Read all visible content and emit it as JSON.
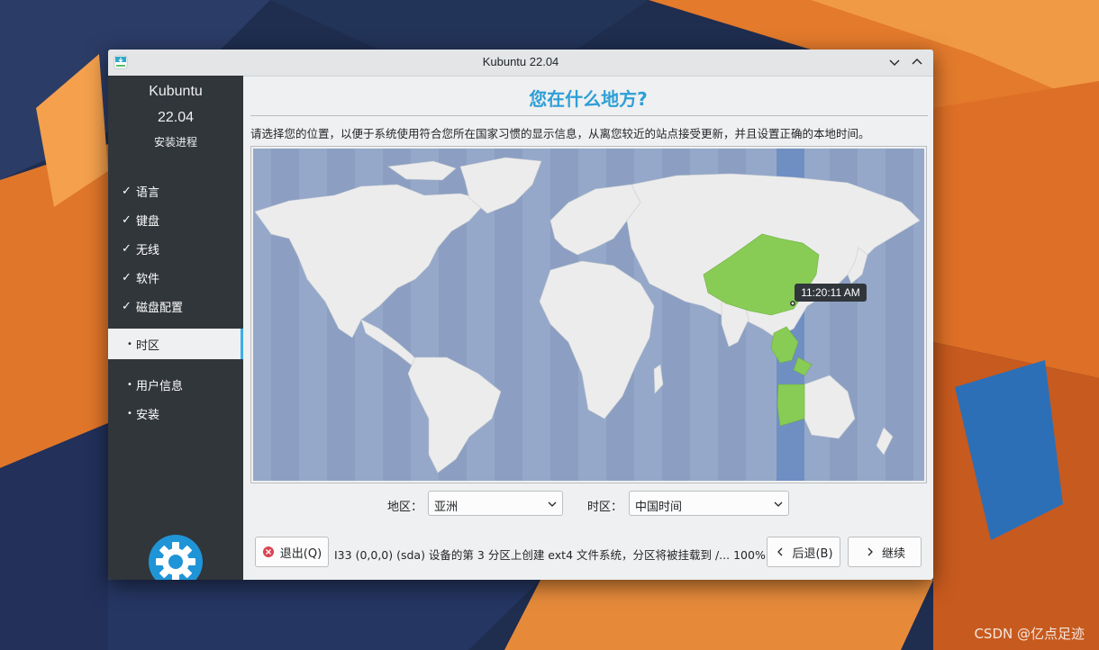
{
  "window": {
    "title": "Kubuntu 22.04"
  },
  "sidebar": {
    "product_name": "Kubuntu",
    "version": "22.04",
    "subtitle": "安装进程",
    "steps": [
      {
        "label": "语言",
        "state": "done",
        "mark": "✓"
      },
      {
        "label": "键盘",
        "state": "done",
        "mark": "✓"
      },
      {
        "label": "无线",
        "state": "done",
        "mark": "✓"
      },
      {
        "label": "软件",
        "state": "done",
        "mark": "✓"
      },
      {
        "label": "磁盘配置",
        "state": "done",
        "mark": "✓"
      },
      {
        "label": "时区",
        "state": "current",
        "mark": "•"
      },
      {
        "label": "用户信息",
        "state": "pending",
        "mark": "•"
      },
      {
        "label": "安装",
        "state": "pending",
        "mark": "•"
      }
    ]
  },
  "main": {
    "title": "您在什么地方?",
    "description": "请选择您的位置，以便于系统使用符合您所在国家习惯的显示信息，从离您较近的站点接受更新，并且设置正确的本地时间。",
    "map": {
      "time_label": "11:20:11 AM",
      "highlight_color": "#88cc55",
      "zone_color": "#6f8fc3"
    },
    "region": {
      "label": "地区：",
      "value": "亚洲"
    },
    "zone": {
      "label": "时区：",
      "value": "中国时间"
    }
  },
  "footer": {
    "quit_label": "退出(Q)",
    "status": "I33 (0,0,0) (sda) 设备的第 3 分区上创建 ext4 文件系统，分区将被挂载到 /... 100%",
    "back_label": "后退(B)",
    "next_label": "继续"
  },
  "watermark": "CSDN @亿点足迹",
  "colors": {
    "accent": "#3daee9",
    "sidebar_bg": "#31363b",
    "map_ocean": "#95a8c9"
  }
}
